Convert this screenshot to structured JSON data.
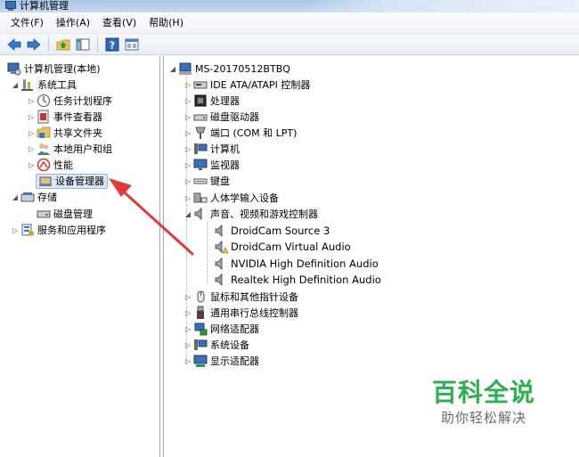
{
  "window": {
    "title": "计算机管理"
  },
  "menu": [
    "文件(F)",
    "操作(A)",
    "查看(V)",
    "帮助(H)"
  ],
  "toolbar": [
    "back-icon",
    "forward-icon",
    "up-folder-icon",
    "show-hide-tree-icon",
    "help-icon",
    "properties-icon"
  ],
  "left_tree": {
    "root": "计算机管理(本地)",
    "system_tools": "系统工具",
    "task_scheduler": "任务计划程序",
    "event_viewer": "事件查看器",
    "shared_folders": "共享文件夹",
    "local_users": "本地用户和组",
    "performance": "性能",
    "device_manager": "设备管理器",
    "storage": "存储",
    "disk_management": "磁盘管理",
    "services_apps": "服务和应用程序"
  },
  "device_tree": {
    "root": "MS-20170512BTBQ",
    "categories": [
      "IDE ATA/ATAPI 控制器",
      "处理器",
      "磁盘驱动器",
      "端口 (COM 和 LPT)",
      "计算机",
      "监视器",
      "键盘",
      "人体学输入设备",
      "声音、视频和游戏控制器",
      "鼠标和其他指针设备",
      "通用串行总线控制器",
      "网络适配器",
      "系统设备",
      "显示适配器"
    ],
    "sound_children": [
      "DroidCam Source 3",
      "DroidCam Virtual Audio",
      "NVIDIA High Definition Audio",
      "Realtek High Definition Audio"
    ]
  },
  "watermark": {
    "title": "百科全说",
    "subtitle": "助你轻松解决"
  },
  "colors": {
    "accent_green": "#2fae50",
    "arrow_red": "#e03a3a",
    "selection": "#dfe8f6"
  }
}
